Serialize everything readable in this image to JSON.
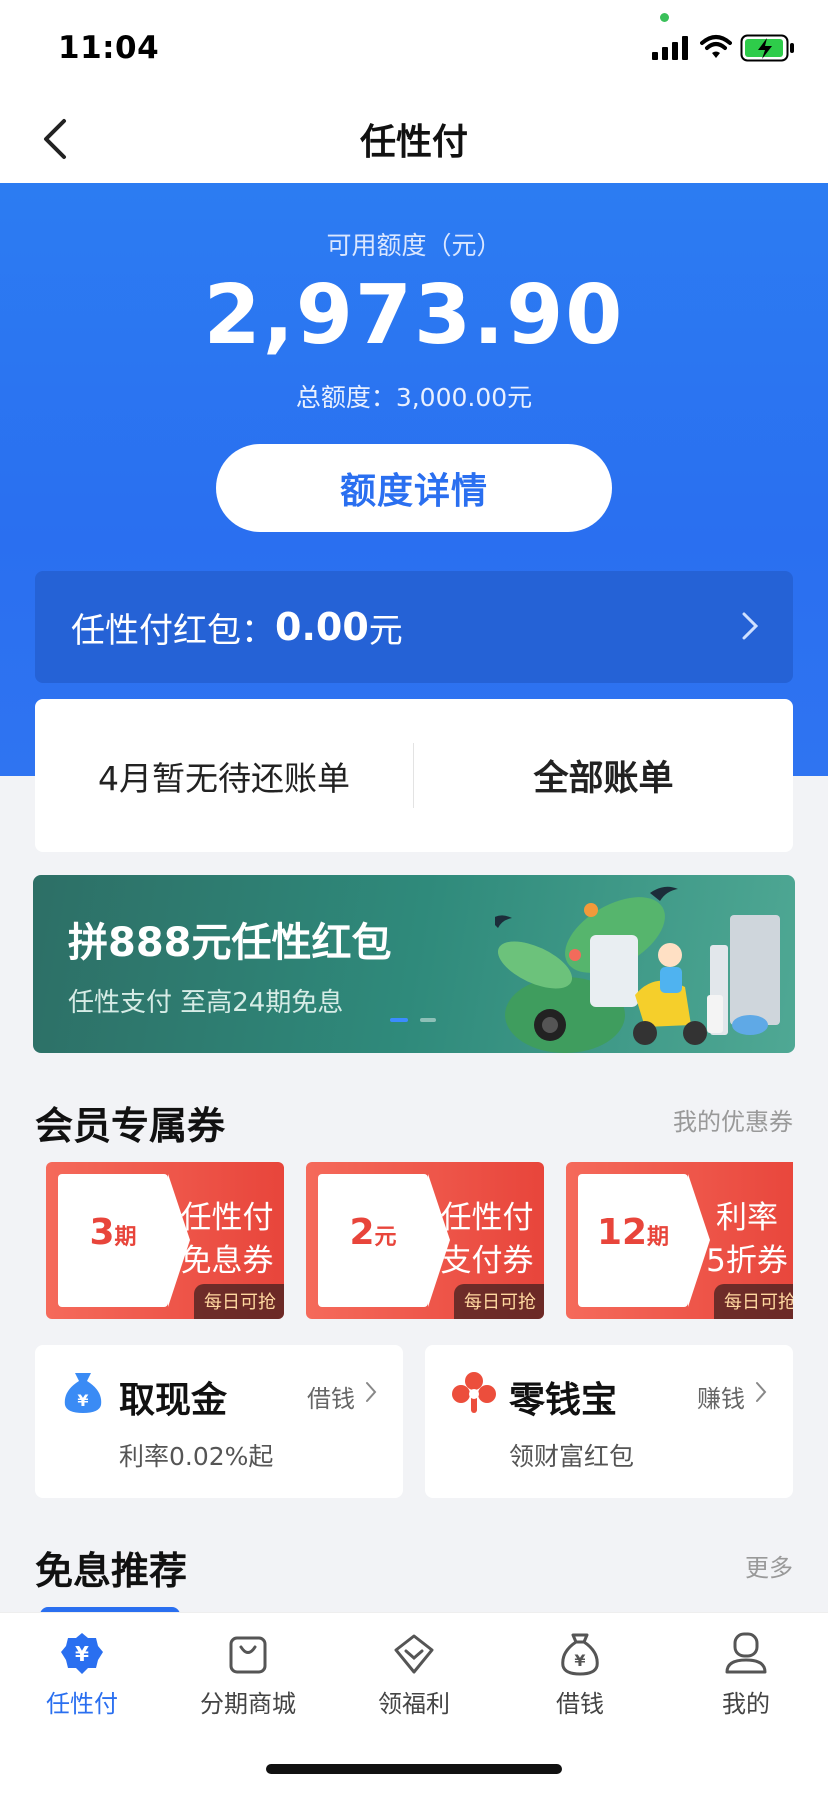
{
  "status": {
    "time": "11:04"
  },
  "nav": {
    "title": "任性付"
  },
  "credit": {
    "available_label": "可用额度（元）",
    "available_amount": "2,973.90",
    "total_label": "总额度：",
    "total_value": "3,000.00元",
    "detail_button": "额度详情"
  },
  "redpack": {
    "label": "任性付红包：",
    "value": "0.00",
    "unit": "元"
  },
  "bills": {
    "current": "4月暂无待还账单",
    "all": "全部账单"
  },
  "banner": {
    "title": "拼888元任性红包",
    "subtitle": "任性支付 至高24期免息",
    "page_index": 1,
    "page_count": 2
  },
  "coupons_section": {
    "title": "会员专属券",
    "link": "我的优惠券",
    "items": [
      {
        "num": "3",
        "unit": "期",
        "line1": "任性付",
        "line2": "免息券",
        "tag": "每日可抢"
      },
      {
        "num": "2",
        "unit": "元",
        "line1": "任性付",
        "line2": "支付券",
        "tag": "每日可抢"
      },
      {
        "num": "12",
        "unit": "期",
        "line1": "利率",
        "line2": "5折券",
        "tag": "每日可抢"
      }
    ]
  },
  "cash_cards": [
    {
      "title": "取现金",
      "link": "借钱",
      "subtitle": "利率0.02%起",
      "icon": "money-bag-icon",
      "color": "#3a8bf5"
    },
    {
      "title": "零钱宝",
      "link": "赚钱",
      "subtitle": "领财富红包",
      "icon": "clover-icon",
      "color": "#ec4e3c"
    }
  ],
  "recommend": {
    "title": "免息推荐",
    "link": "更多"
  },
  "tabs": [
    {
      "label": "任性付",
      "icon": "yuan-badge-icon",
      "active": true
    },
    {
      "label": "分期商城",
      "icon": "shopping-bag-icon",
      "active": false
    },
    {
      "label": "领福利",
      "icon": "gift-heart-icon",
      "active": false
    },
    {
      "label": "借钱",
      "icon": "money-bag-icon",
      "active": false
    },
    {
      "label": "我的",
      "icon": "profile-icon",
      "active": false
    }
  ],
  "colors": {
    "primary": "#2a6ff0",
    "coupon_red": "#e8453b",
    "banner_green": "#2f8a7b"
  }
}
